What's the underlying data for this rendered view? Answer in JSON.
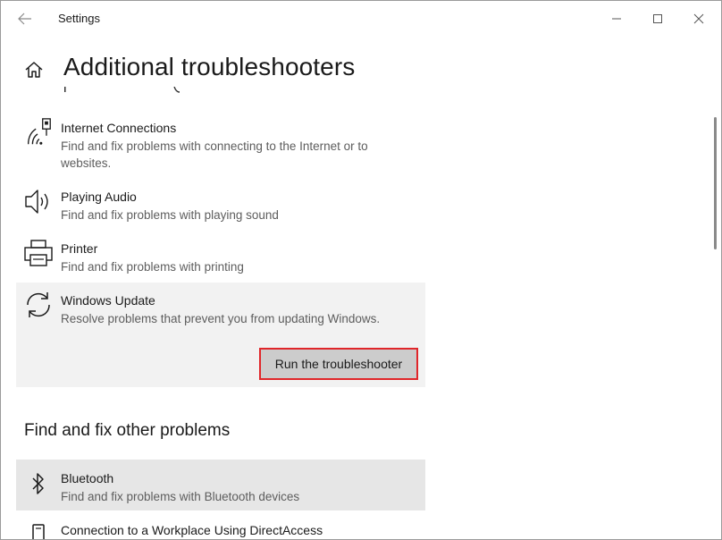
{
  "window": {
    "title": "Settings"
  },
  "header": {
    "title": "Additional troubleshooters"
  },
  "items": [
    {
      "name": "Internet Connections",
      "description": "Find and fix problems with connecting to the Internet or to websites.",
      "icon": "wifi-warning-icon"
    },
    {
      "name": "Playing Audio",
      "description": "Find and fix problems with playing sound",
      "icon": "speaker-icon"
    },
    {
      "name": "Printer",
      "description": "Find and fix problems with printing",
      "icon": "printer-icon"
    },
    {
      "name": "Windows Update",
      "description": "Resolve problems that prevent you from updating Windows.",
      "icon": "refresh-icon",
      "action_label": "Run the troubleshooter"
    }
  ],
  "other_section": {
    "heading": "Find and fix other problems",
    "items": [
      {
        "name": "Bluetooth",
        "description": "Find and fix problems with Bluetooth devices",
        "icon": "bluetooth-icon"
      },
      {
        "name": "Connection to a Workplace Using DirectAccess",
        "icon": "phone-device-icon"
      }
    ]
  },
  "colors": {
    "selected_bg": "#f2f2f2",
    "hover_bg": "#e6e6e6",
    "button_bg": "#cccccc",
    "highlight_border": "#e0262a",
    "secondary_text": "#5d5d5d"
  }
}
